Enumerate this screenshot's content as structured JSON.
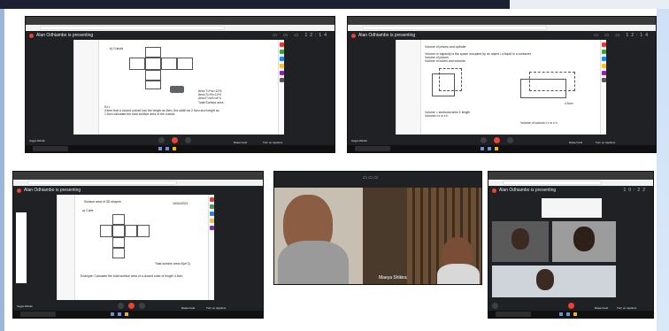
{
  "panels": [
    {
      "id": "top-left",
      "presenting": "Alan Odhiambo is presenting",
      "meeting_code": "hugpx-ffxbdm",
      "time": "12:14"
    },
    {
      "id": "top-right",
      "presenting": "Alan Odhiambo is presenting",
      "meeting_code": "hugpx-ffxbdm",
      "time": "12:14",
      "heading": "Volume of prisms and cylinder",
      "measure_label": "4.5cm"
    },
    {
      "id": "bottom-left",
      "presenting": "Alan Odhiambo is presenting",
      "meeting_code": "hugpx-ffxbdm",
      "heading": "Surface area of 3D shapes",
      "date": "16/04/2021",
      "subheading": "a) Cube",
      "total": "Total surface area=6(a^2)",
      "example": "Example: Calculate the total surface area of a closed cube of length 4.5cm"
    },
    {
      "id": "bottom-middle",
      "participant_name": "Maeya Shikira"
    },
    {
      "id": "bottom-right",
      "presenting": "Alan Odhiambo is presenting",
      "time": "10:22"
    }
  ],
  "controls": {
    "raise_hand": "Raise hand",
    "turn_on_captions": "Turn on captions",
    "alan_presenting": "Alan Odhiambo is presenting"
  },
  "colors": {
    "meet_bg": "#202124",
    "end_call": "#ea4335",
    "taskbar": "#111111"
  }
}
